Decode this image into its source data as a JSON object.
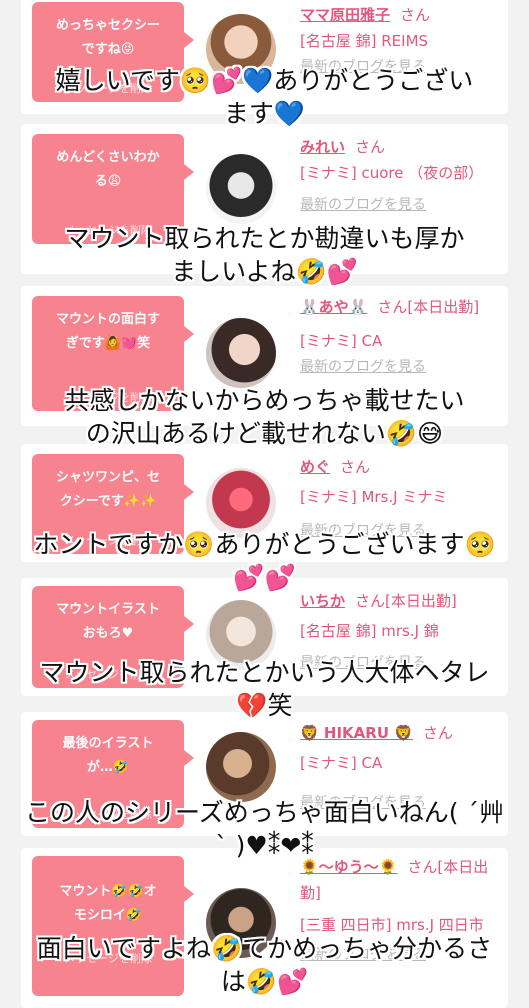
{
  "cards": [
    {
      "message": "めっちゃセクシー\nですね😝",
      "delete_label": "メッセージを削除",
      "name": "ママ原田雅子",
      "san": "さん",
      "shop": "[名古屋 錦] REIMS",
      "blog": "最新のブログを見る"
    },
    {
      "message": "めんどくさいわか\nる😩",
      "delete_label": "メッセージを削除",
      "name": "みれい",
      "san": "さん",
      "shop": "[ミナミ] cuore （夜の部）",
      "blog": "最新のブログを見る"
    },
    {
      "message": "マウントの面白す\nぎです🙆💓笑",
      "delete_label": "メッセージを削除",
      "name": "🐰あや🐰",
      "san": "さん[本日出勤]",
      "shop": "[ミナミ] CA",
      "blog": "最新のブログを見る"
    },
    {
      "message": "シャツワンピ、セ\nクシーです✨✨",
      "delete_label": "メッセージを削除",
      "name": "めぐ",
      "san": "さん",
      "shop": "[ミナミ] Mrs.J ミナミ",
      "blog": "最新のブログを見る"
    },
    {
      "message": "マウントイラスト\nおもろ♥",
      "delete_label": "メッセージを削除",
      "name": "いちか",
      "san": "さん[本日出勤]",
      "shop": "[名古屋 錦] mrs.J 錦",
      "blog": "最新のブログを見る"
    },
    {
      "message": "最後のイラスト\nが…🤣",
      "delete_label": "メッセージを削除",
      "name": "🦁 HIKARU 🦁",
      "san": "さん",
      "shop": "[ミナミ] CA",
      "blog": "最新のブログを見る"
    },
    {
      "message": "マウント🤣🤣オ\nモシロイ🤣",
      "delete_label": "メッセージを削除",
      "name": "🌻〜ゆう〜🌻",
      "san": "さん[本日出勤]",
      "shop": "[三重 四日市] mrs.J 四日市",
      "blog": "最新のブログを見る"
    }
  ],
  "overlays": [
    "嬉しいです🥺💕💙ありがとうござい\nます💙",
    "マウント取られたとか勘違いも厚か\nましいよね🤣💕",
    "共感しかないからめっちゃ載せたい\nの沢山あるけど載せれない🤣😅",
    "ホントですか🥺ありがとうございます🥺\n💕💕",
    "マウント取られたとかいう人大体ヘタレ\n💔笑",
    "この人のシリーズめっちゃ面白いねん( ´艸\n` )♥⁑❤⁑",
    "面白いですよね🤣てかめっちゃ分かるさ\nは🤣💕"
  ],
  "colors": {
    "bubble": "#f7838f",
    "accent": "#e2577a",
    "muted": "#b8b8b8"
  }
}
